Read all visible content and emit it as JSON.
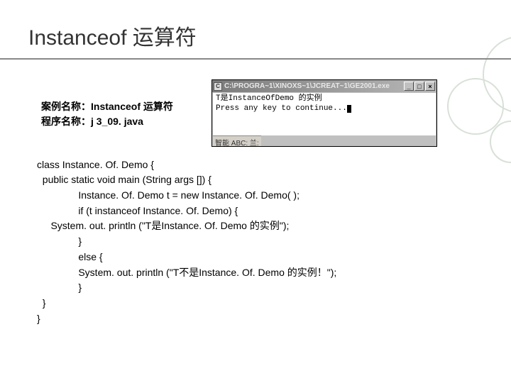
{
  "title": "Instanceof 运算符",
  "meta": {
    "label_case": "案例名称：",
    "case_name": "Instanceof 运算符",
    "label_prog": "程序名称：",
    "prog_name": "j 3_09. java"
  },
  "code": {
    "l1": "class Instance. Of. Demo {",
    "l2": "  public static void main (String args []) {",
    "l3": "               Instance. Of. Demo t = new Instance. Of. Demo( );",
    "l4": "               if (t instanceof Instance. Of. Demo) {",
    "l5": "     System. out. println (\"T是Instance. Of. Demo 的实例\");",
    "l6": "               }",
    "l7": "               else {",
    "l8": "               System. out. println (\"T不是Instance. Of. Demo 的实例！\");",
    "l9": "               }",
    "l10": "  }",
    "l11": "}"
  },
  "console": {
    "title": "C:\\PROGRA~1\\XINOXS~1\\JCREAT~1\\GE2001.exe",
    "line1": "T是InstanceOfDemo 的实例",
    "line2": "Press any key to continue...",
    "ime": "智能 ABC: 兰:",
    "btn_min": "_",
    "btn_max": "□",
    "btn_close": "×",
    "icon_glyph": "C"
  }
}
